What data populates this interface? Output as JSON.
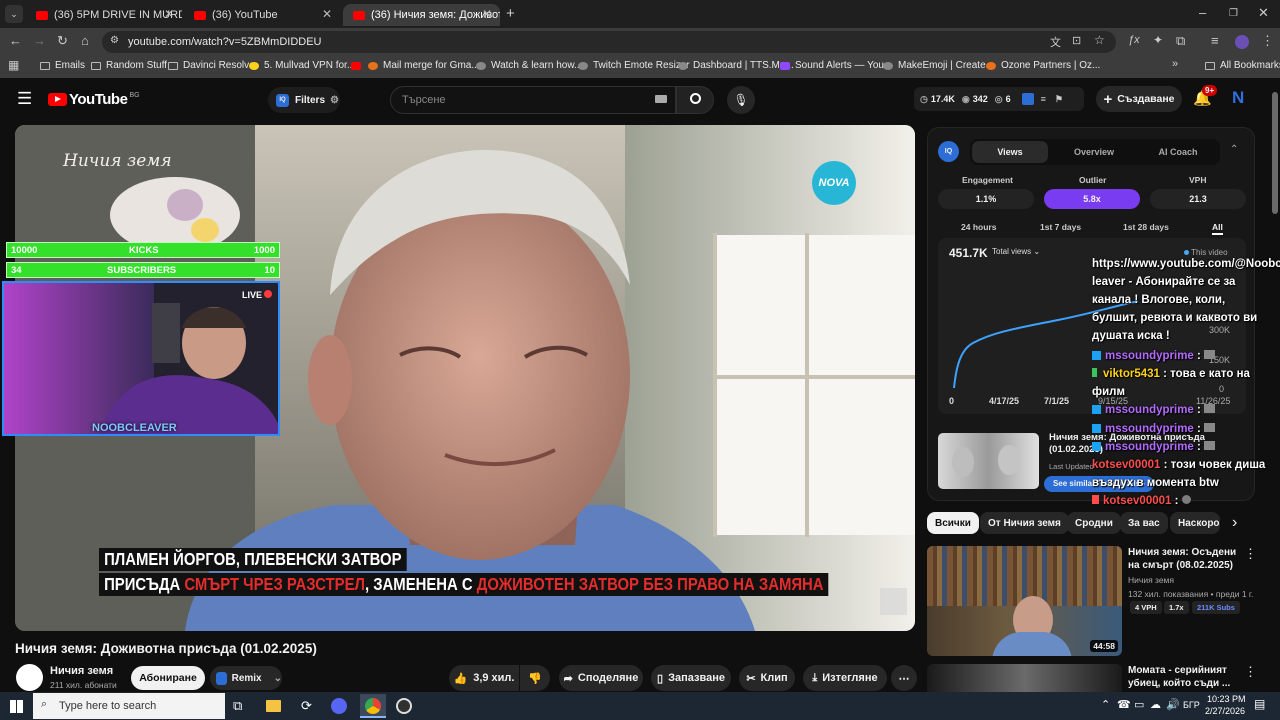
{
  "browser": {
    "tabs": [
      {
        "title": "(36) 5PM DRIVE IN MURDERED",
        "active": false
      },
      {
        "title": "(36) YouTube",
        "active": false
      },
      {
        "title": "(36) Ничия земя: Доживотна",
        "active": true
      }
    ],
    "url": "youtube.com/watch?v=5ZBMmDIDDEU",
    "bookmarks": [
      "Emails",
      "Random Stuff",
      "Davinci Resolve",
      "5. Mullvad VPN for...",
      "Mail merge for Gma...",
      "Watch & learn how...",
      "Twitch Emote Resizer",
      "Dashboard | TTS.Mo...",
      "Sound Alerts — You...",
      "MakeEmoji | Create...",
      "Ozone Partners | Oz..."
    ],
    "all_bookmarks": "All Bookmarks"
  },
  "youtube": {
    "logo": "YouTube",
    "region": "BG",
    "filters": "Filters",
    "search_placeholder": "Търсене",
    "stats": {
      "views": "17.4K",
      "watching": "342",
      "count": "6"
    },
    "create_label": "Създаване",
    "notif_count": "9+",
    "avatar_letter": "N"
  },
  "video": {
    "watermark": "Ничия земя",
    "channel_logo": "NOVA",
    "subtitle_line1": "ПЛАМЕН ЙОРГОВ, ПЛЕВЕНСКИ ЗАТВОР",
    "subtitle_line2_a": "ПРИСЪДА ",
    "subtitle_line2_b": "СМЪРТ ЧРЕЗ РАЗСТРЕЛ",
    "subtitle_line2_c": ", ЗАМЕНЕНА С ",
    "subtitle_line2_d": "ДОЖИВОТЕН ЗАТВОР БЕЗ ПРАВО НА ЗАМЯНА",
    "title": "Ничия земя: Доживотна присъда (01.02.2025)",
    "channel": "Ничия земя",
    "subscribers": "211 хил. абонати",
    "subscribe_label": "Абониране",
    "remix_label": "Remix",
    "likes": "3,9 хил.",
    "share_label": "Споделяне",
    "save_label": "Запазване",
    "clip_label": "Клип",
    "download_label": "Изтегляне"
  },
  "overlay": {
    "kicks_left": "10000",
    "kicks_label": "KICKS",
    "kicks_right": "1000",
    "subs_left": "34",
    "subs_label": "SUBSCRIBERS",
    "subs_right": "10",
    "live": "LIVE",
    "streamer": "NOOBCLEAVER",
    "chat_intro": "https://www.youtube.com/@Noobc leaver - Абонирайте се за канала ! Влогове, коли, булшит, ревюта и каквото ви душата иска !",
    "chat": [
      {
        "user": "mssoundyprime",
        "text": "",
        "color": "u"
      },
      {
        "user": "viktor5431",
        "text": "това е като на филм",
        "color": "g"
      },
      {
        "user": "mssoundyprime",
        "text": "",
        "color": "u"
      },
      {
        "user": "mssoundyprime",
        "text": "",
        "color": "u"
      },
      {
        "user": "mssoundyprime",
        "text": "",
        "color": "u"
      },
      {
        "user": "kotsev00001",
        "text": "този човек диша въздух в момента btw",
        "color": "r"
      },
      {
        "user": "kotsev00001",
        "text": "",
        "color": "r"
      }
    ]
  },
  "vidiq": {
    "tabs": [
      "Views",
      "Overview",
      "AI Coach"
    ],
    "metrics": [
      {
        "label": "Engagement",
        "value": "1.1%"
      },
      {
        "label": "Outlier",
        "value": "5.8x"
      },
      {
        "label": "VPH",
        "value": "21.3"
      }
    ],
    "ranges": [
      "24 hours",
      "1st 7 days",
      "1st 28 days",
      "All"
    ],
    "total": "451.7K",
    "total_label": "Total views",
    "this_video": "This video",
    "y_ticks": [
      "300K",
      "150K",
      "0"
    ],
    "x_ticks": [
      "0",
      "4/17/25",
      "7/1/25",
      "9/15/25",
      "11/26/25"
    ],
    "thumb_title": "Ничия земя: Доживотна присъда (01.02.2025)",
    "last_updated": "Last Updated",
    "see_similar": "See similar thumbnails"
  },
  "chips": [
    "Всички",
    "От Ничия земя",
    "Сродни",
    "За вас",
    "Наскоро"
  ],
  "recommendations": [
    {
      "title": "Ничия земя: Осъдени на смърт (08.02.2025)",
      "channel": "Ничия земя",
      "meta": "132 хил. показвания • преди 1 г.",
      "vph": "4 VPH",
      "outlier": "1.7x",
      "subs": "211K Subs",
      "duration": "44:58"
    },
    {
      "title": "Момата - серийният убиец, който съди ..."
    }
  ],
  "taskbar": {
    "search": "Type here to search",
    "lang": "БГР",
    "time": "10:23 PM",
    "date": "2/27/2026"
  }
}
